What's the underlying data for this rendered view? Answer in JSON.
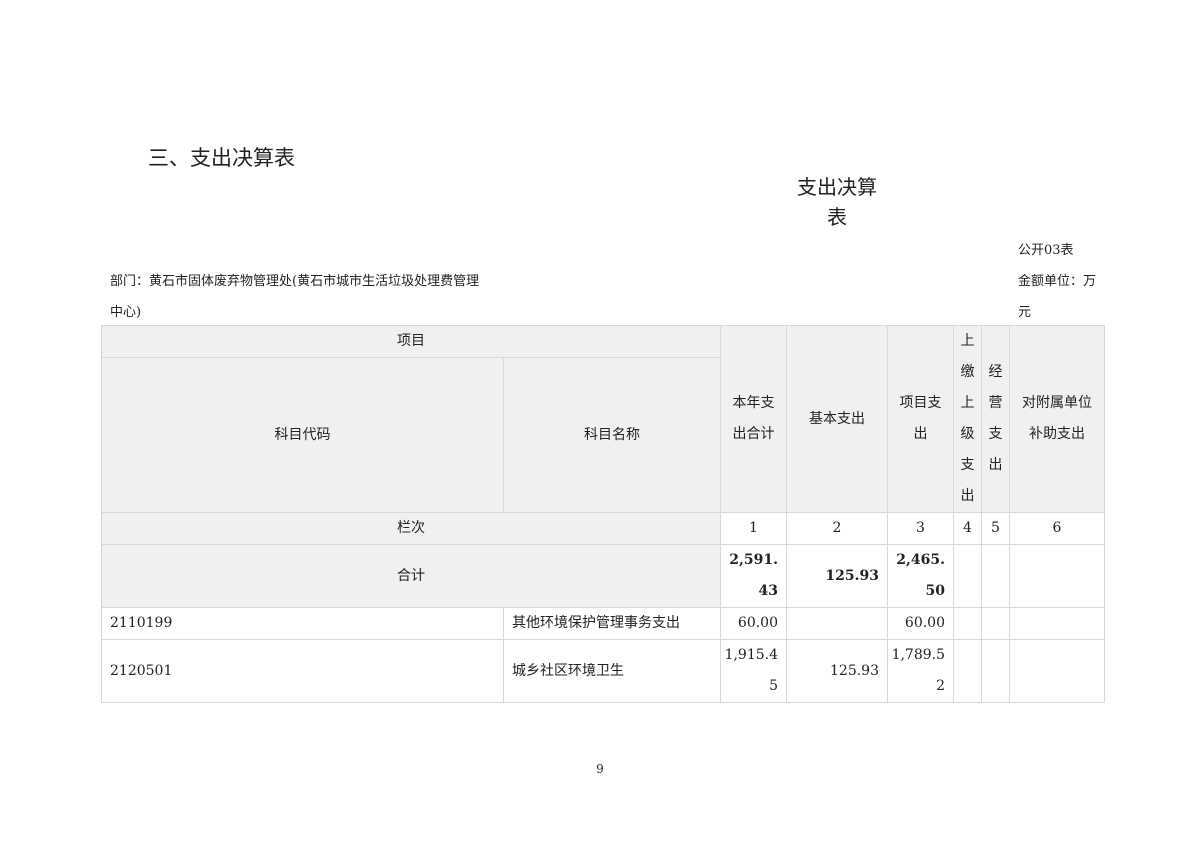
{
  "section_title": "三、支出决算表",
  "table_title_line1": "支出决算",
  "table_title_line2": "表",
  "table_code": "公开03表",
  "unit_label": "金额单位：万元",
  "department": "部门：黄石市固体废弃物管理处(黄石市城市生活垃圾处理费管理中心)",
  "header": {
    "item": "项目",
    "subject_code": "科目代码",
    "subject_name": "科目名称",
    "total": "本年支出合计",
    "basic": "基本支出",
    "project": "项目支出",
    "upper": "上缴上级支出",
    "operating": "经营支出",
    "subsidy": "对附属单位补助支出"
  },
  "column_row": {
    "label": "栏次",
    "numbers": [
      "1",
      "2",
      "3",
      "4",
      "5",
      "6"
    ]
  },
  "total_row": {
    "label": "合计",
    "total": "2,591.43",
    "basic": "125.93",
    "project": "2,465.50",
    "upper": "",
    "operating": "",
    "subsidy": ""
  },
  "rows": [
    {
      "code": "2110199",
      "name": "其他环境保护管理事务支出",
      "total": "60.00",
      "basic": "",
      "project": "60.00",
      "upper": "",
      "operating": "",
      "subsidy": ""
    },
    {
      "code": "2120501",
      "name": "城乡社区环境卫生",
      "total": "1,915.45",
      "basic": "125.93",
      "project": "1,789.52",
      "upper": "",
      "operating": "",
      "subsidy": ""
    }
  ],
  "page_number": "9"
}
